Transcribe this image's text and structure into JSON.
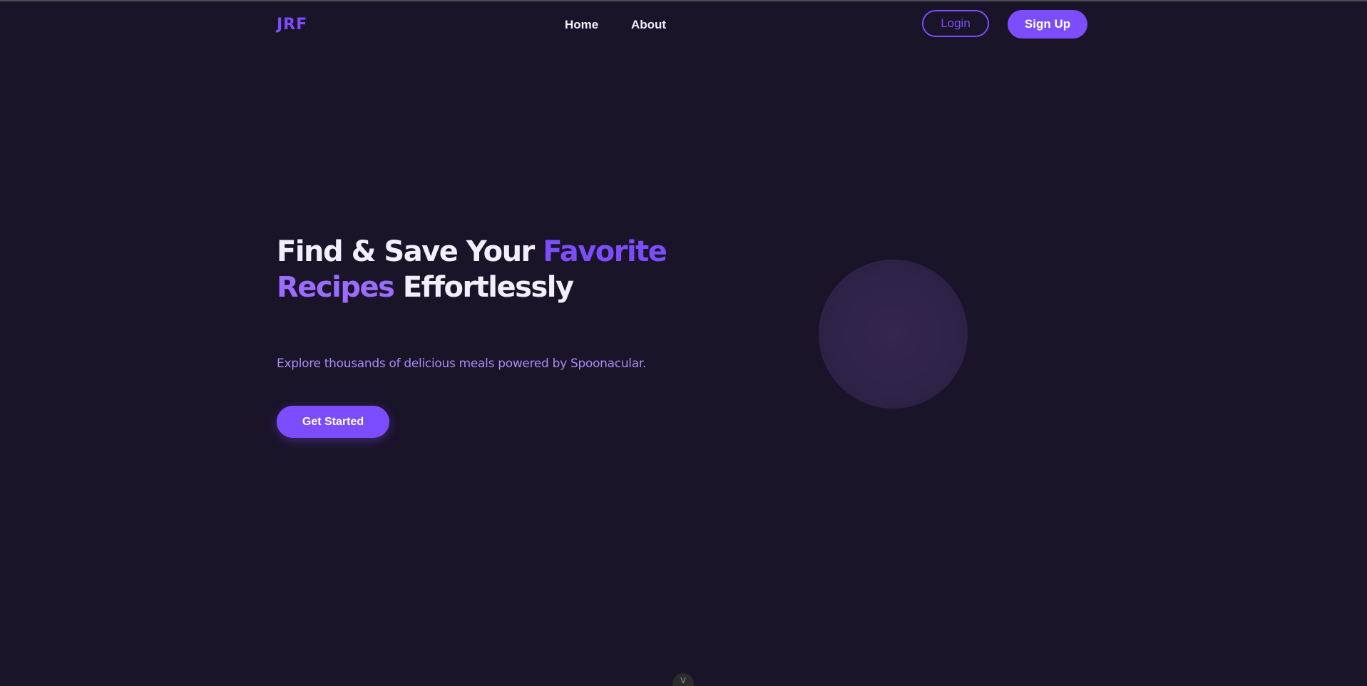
{
  "header": {
    "logo": "JRF",
    "nav": [
      {
        "label": "Home"
      },
      {
        "label": "About"
      }
    ],
    "login_label": "Login",
    "signup_label": "Sign Up"
  },
  "hero": {
    "title_part1": "Find & Save Your ",
    "title_accent1": "Favorite",
    "title_accent2": "Recipes",
    "title_part2": " Effortlessly",
    "subtitle": "Explore thousands of delicious meals powered by Spoonacular.",
    "cta_label": "Get Started"
  },
  "scroll_indicator": {
    "icon": "chevron-down-icon",
    "glyph": "v"
  },
  "colors": {
    "background": "#1a1429",
    "accent": "#7c4dff",
    "text": "#f2eefa",
    "subtitle": "#a98bf5",
    "circle": "#2d2246"
  }
}
